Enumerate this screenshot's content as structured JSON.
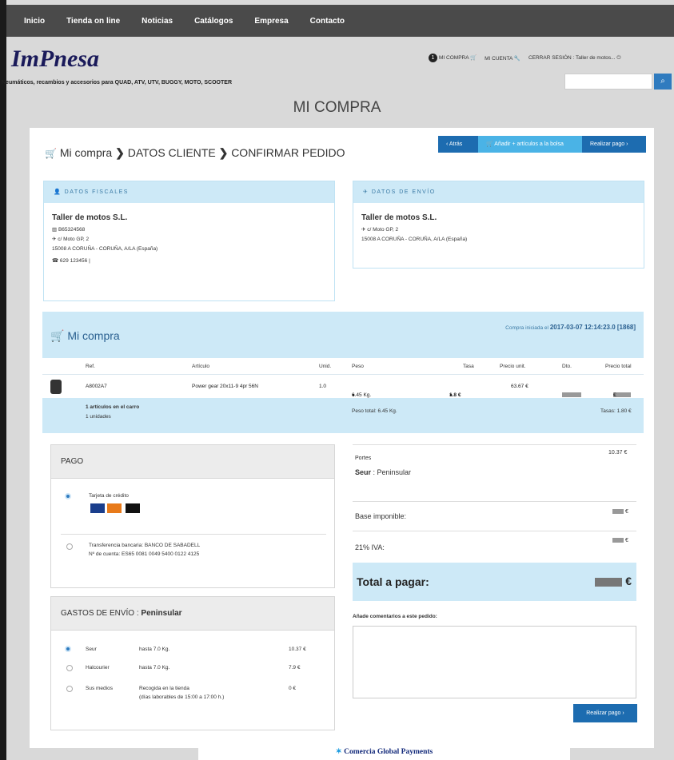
{
  "nav": [
    "Inicio",
    "Tienda on line",
    "Noticias",
    "Catálogos",
    "Empresa",
    "Contacto"
  ],
  "brand": {
    "logo": "ImPnesa",
    "tagline": "Neumáticos, recambios y accesorios para QUAD, ATV, UTV, BUGGY, MOTO, SCOOTER"
  },
  "usernav": {
    "cart_count": "1",
    "cart": "MI COMPRA",
    "account": "MI CUENTA",
    "logout": "CERRAR SESIÓN : Taller de motos..."
  },
  "page_title": "MI COMPRA",
  "steps": {
    "s1": "Mi compra",
    "s2": "DATOS CLIENTE",
    "s3": "CONFIRMAR PEDIDO"
  },
  "buttons": {
    "back": "Atrás",
    "add": "Añadir + artículos a la bolsa",
    "pay": "Realizar pago"
  },
  "fiscal": {
    "title": "DATOS FISCALES",
    "name": "Taller de motos S.L.",
    "id": "B65324568",
    "street": "c/ Moto GP, 2",
    "city": "15008 A CORUÑA - CORUÑA, A/LA (España)",
    "phone": "629 123456 |"
  },
  "shipping": {
    "title": "DATOS DE ENVÍO",
    "name": "Taller de motos S.L.",
    "street": "c/ Moto GP, 2",
    "city": "15008 A CORUÑA - CORUÑA, A/LA (España)"
  },
  "cart": {
    "title": "Mi compra",
    "started_label": "Compra iniciada el",
    "started_value": "2017-03-07 12:14:23.0 [1868]",
    "headers": [
      "Ref.",
      "Artículo",
      "Unid.",
      "Peso",
      "Tasa",
      "Precio unit.",
      "Dto.",
      "Precio total"
    ],
    "row": {
      "ref": "A8002A7",
      "article": "Power gear 20x11-9 4pr 56N",
      "units": "1.0",
      "weight": "6.45 Kg.",
      "tax": "1.8 €",
      "unit_price": "63.67 €",
      "total_price": "€"
    },
    "footer": {
      "items": "1 artículos en el carro",
      "units": "1 unidades",
      "total_weight": "Peso total: 6.45 Kg.",
      "taxes": "Tasas: 1.80 €"
    }
  },
  "payment": {
    "title": "PAGO",
    "card": "Tarjeta de crédito",
    "transfer": "Transferencia bancaria: BANCO DE SABADELL",
    "account": "Nº de cuenta: ES65 0081 0049 5400 0122 4125"
  },
  "shipping_costs": {
    "title": "GASTOS DE ENVÍO :",
    "zone": "Peninsular",
    "options": [
      {
        "name": "Seur",
        "limit": "hasta 7.0 Kg.",
        "price": "10.37 €"
      },
      {
        "name": "Halcourier",
        "limit": "hasta 7.0 Kg.",
        "price": "7.9 €"
      },
      {
        "name": "Sus medios",
        "limit": "Recogida en la tienda",
        "limit2": "(días laborables de 15:00 a 17:00 h.)",
        "price": "0 €"
      }
    ]
  },
  "summary": {
    "portes_label": "Portes",
    "portes_value": "10.37 €",
    "carrier": "Seur",
    "carrier_zone": ": Peninsular",
    "base_label": "Base imponible:",
    "base_value": "€",
    "iva_label": "21% IVA:",
    "iva_value": "€",
    "total_label": "Total a pagar:",
    "total_value": "€",
    "comments_label": "Añade comentarios a este pedido:",
    "pay_button": "Realizar pago"
  },
  "gateway": "Comercia Global Payments"
}
